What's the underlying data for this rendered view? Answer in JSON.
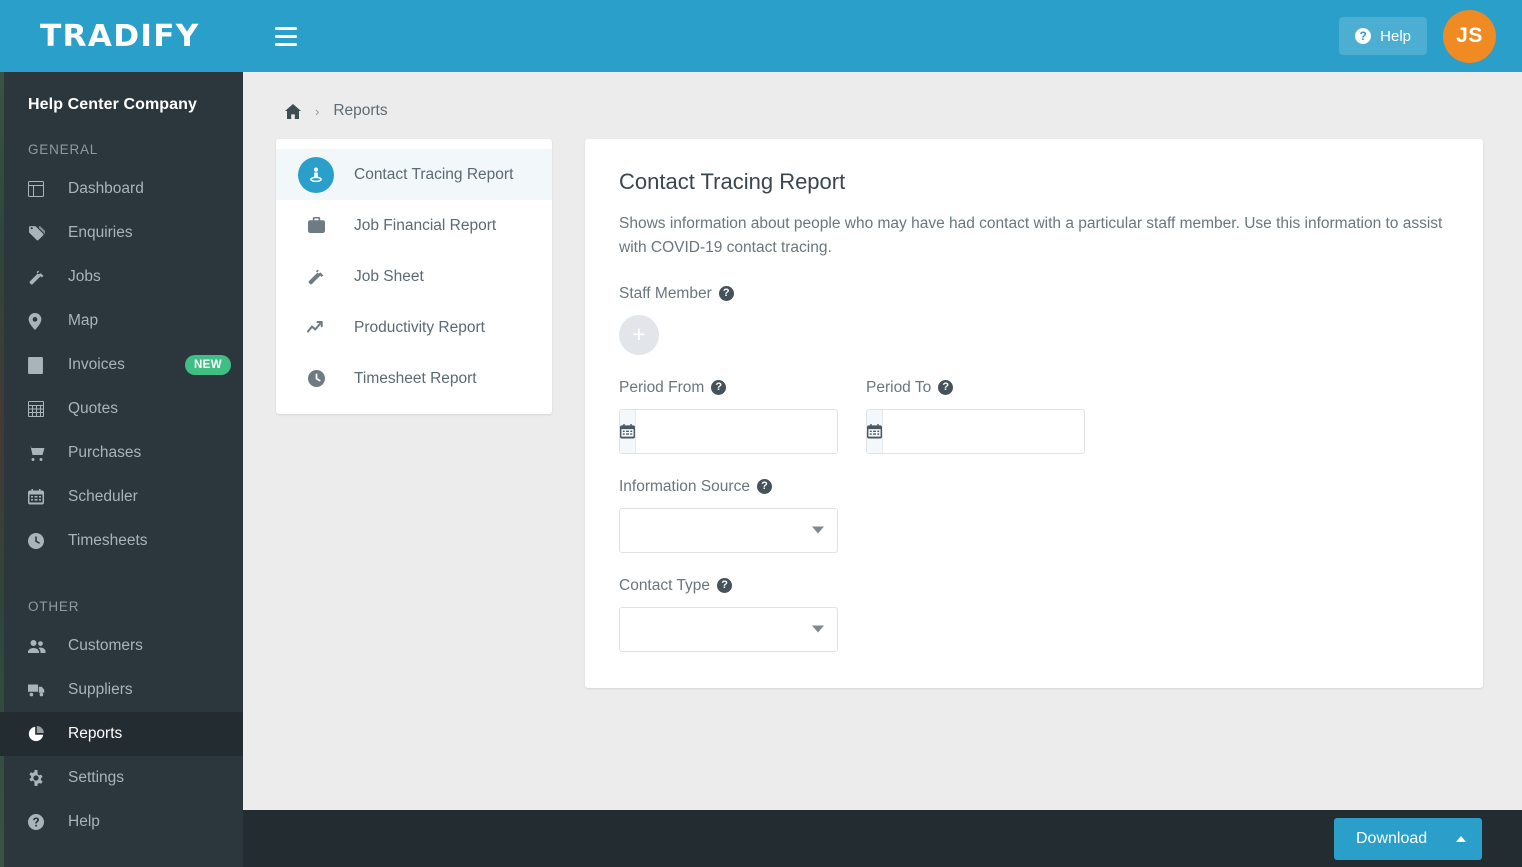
{
  "header": {
    "brand": "TRADIFY",
    "menu_icon": "hamburger-icon",
    "help_label": "Help",
    "help_icon": "question-circle-icon",
    "avatar_initials": "JS",
    "accent_color": "#2a9fc9",
    "avatar_color": "#ef8b22"
  },
  "sidebar": {
    "company": "Help Center Company",
    "groups": [
      {
        "label": "GENERAL",
        "items": [
          {
            "label": "Dashboard",
            "icon": "dashboard-icon",
            "active": false,
            "badge": ""
          },
          {
            "label": "Enquiries",
            "icon": "tag-icon",
            "active": false,
            "badge": ""
          },
          {
            "label": "Jobs",
            "icon": "hammer-icon",
            "active": false,
            "badge": ""
          },
          {
            "label": "Map",
            "icon": "map-pin-icon",
            "active": false,
            "badge": ""
          },
          {
            "label": "Invoices",
            "icon": "invoice-icon",
            "active": false,
            "badge": "NEW"
          },
          {
            "label": "Quotes",
            "icon": "grid-icon",
            "active": false,
            "badge": ""
          },
          {
            "label": "Purchases",
            "icon": "cart-icon",
            "active": false,
            "badge": ""
          },
          {
            "label": "Scheduler",
            "icon": "calendar-icon",
            "active": false,
            "badge": ""
          },
          {
            "label": "Timesheets",
            "icon": "clock-icon",
            "active": false,
            "badge": ""
          }
        ]
      },
      {
        "label": "OTHER",
        "items": [
          {
            "label": "Customers",
            "icon": "users-icon",
            "active": false,
            "badge": ""
          },
          {
            "label": "Suppliers",
            "icon": "truck-icon",
            "active": false,
            "badge": ""
          },
          {
            "label": "Reports",
            "icon": "pie-chart-icon",
            "active": true,
            "badge": ""
          },
          {
            "label": "Settings",
            "icon": "gear-icon",
            "active": false,
            "badge": ""
          },
          {
            "label": "Help",
            "icon": "help-circle-icon",
            "active": false,
            "badge": ""
          }
        ]
      }
    ],
    "badge_color": "#3fbf83"
  },
  "breadcrumb": {
    "home_icon": "home-icon",
    "separator": "›",
    "current": "Reports"
  },
  "report_list": {
    "items": [
      {
        "label": "Contact Tracing Report",
        "icon": "person-tracing-icon",
        "selected": true
      },
      {
        "label": "Job Financial Report",
        "icon": "briefcase-icon",
        "selected": false
      },
      {
        "label": "Job Sheet",
        "icon": "hammer-icon",
        "selected": false
      },
      {
        "label": "Productivity Report",
        "icon": "trend-up-icon",
        "selected": false
      },
      {
        "label": "Timesheet Report",
        "icon": "clock-icon",
        "selected": false
      }
    ]
  },
  "form": {
    "title": "Contact Tracing Report",
    "description": "Shows information about people who may have had contact with a particular staff member. Use this information to assist with COVID-19 contact tracing.",
    "staff_member": {
      "label": "Staff Member",
      "help_icon": "question-mark-icon",
      "add_button_icon": "plus-icon",
      "add_button_glyph": "+"
    },
    "period_from": {
      "label": "Period From",
      "help_icon": "question-mark-icon",
      "calendar_icon": "calendar-icon",
      "value": "",
      "placeholder": ""
    },
    "period_to": {
      "label": "Period To",
      "help_icon": "question-mark-icon",
      "calendar_icon": "calendar-icon",
      "value": "",
      "placeholder": ""
    },
    "information_source": {
      "label": "Information Source",
      "help_icon": "question-mark-icon",
      "value": "",
      "caret_icon": "chevron-down-icon"
    },
    "contact_type": {
      "label": "Contact Type",
      "help_icon": "question-mark-icon",
      "value": "",
      "caret_icon": "chevron-down-icon"
    }
  },
  "footer": {
    "download_label": "Download",
    "download_caret_icon": "chevron-up-icon",
    "button_color": "#2a9fc9",
    "bar_color": "#222c31"
  }
}
